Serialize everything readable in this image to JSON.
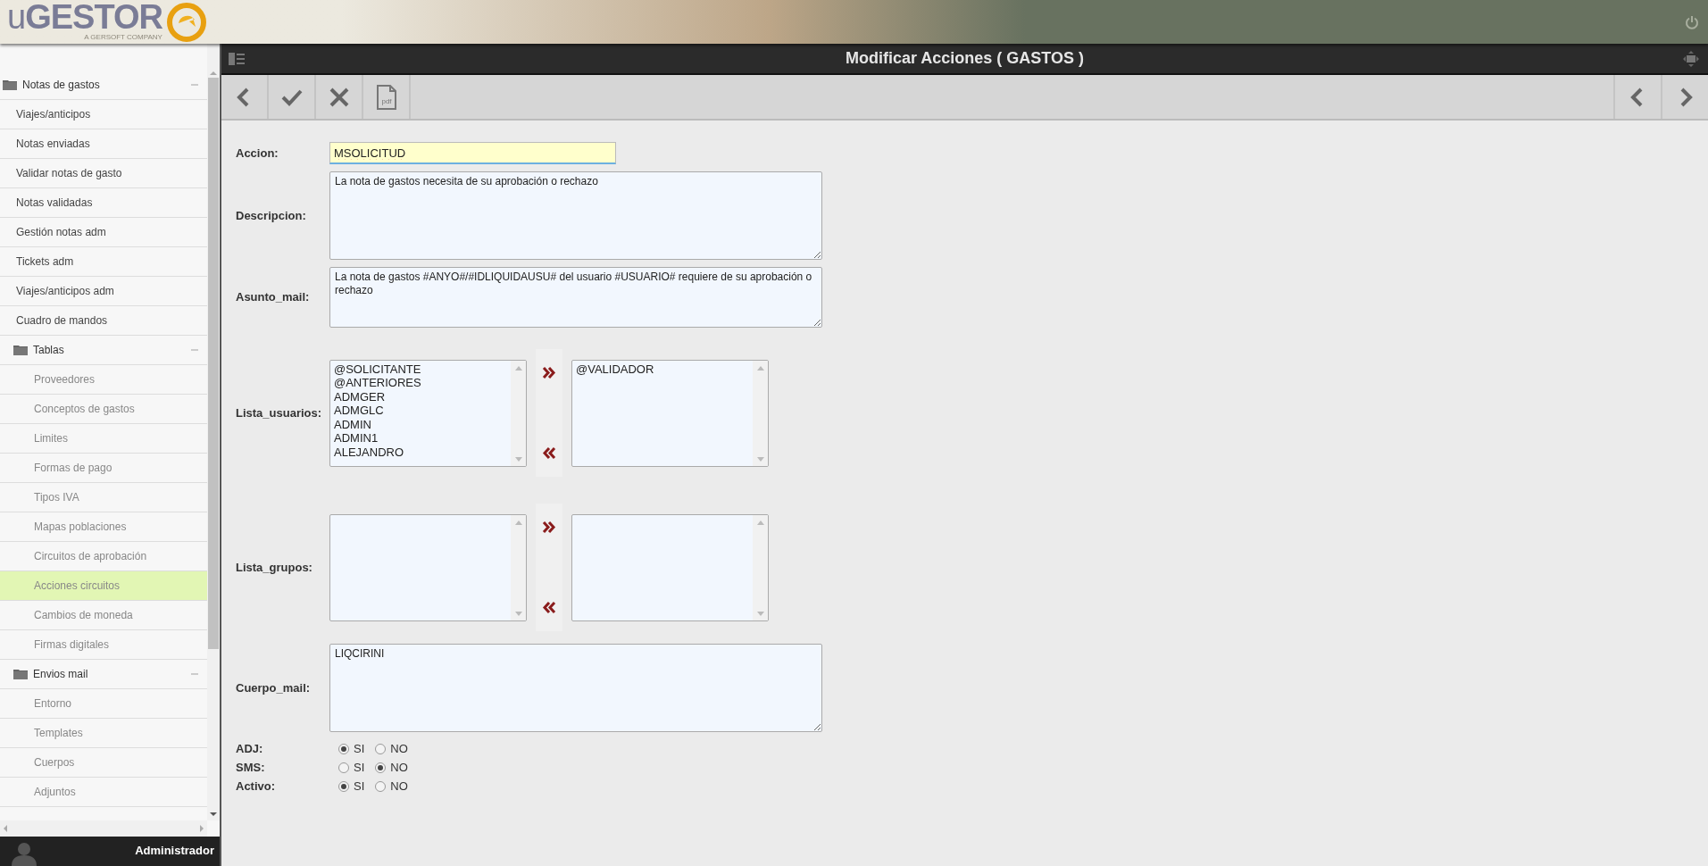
{
  "header": {
    "logo": "u**GESTOR**",
    "tagline": "A GERSOFT COMPANY"
  },
  "sidebar": {
    "items": [
      {
        "label": "Notas de gastos",
        "expanded": true,
        "selected": false,
        "children": [
          {
            "label": "Viajes/anticipos",
            "selected": false
          },
          {
            "label": "Notas enviadas",
            "selected": false
          },
          {
            "label": "Validar notas de gasto",
            "selected": false
          },
          {
            "label": "Notas validadas",
            "selected": false
          },
          {
            "label": "Gestión notas adm",
            "selected": false
          },
          {
            "label": "Tickets adm",
            "selected": false
          },
          {
            "label": "Viajes/anticipos adm",
            "selected": false
          },
          {
            "label": "Cuadro de mandos",
            "selected": false
          },
          {
            "label": "Tablas",
            "expanded": true,
            "selected": false,
            "children": [
              {
                "label": "Proveedores",
                "selected": false
              },
              {
                "label": "Conceptos de gastos",
                "selected": false
              },
              {
                "label": "Limites",
                "selected": false
              },
              {
                "label": "Formas de pago",
                "selected": false
              },
              {
                "label": "Tipos IVA",
                "selected": false
              },
              {
                "label": "Mapas poblaciones",
                "selected": false
              },
              {
                "label": "Circuitos de aprobación",
                "selected": false
              },
              {
                "label": "Acciones circuitos",
                "selected": true
              },
              {
                "label": "Cambios de moneda",
                "selected": false
              },
              {
                "label": "Firmas digitales",
                "selected": false
              }
            ]
          },
          {
            "label": "Envios mail",
            "expanded": true,
            "selected": false,
            "children": [
              {
                "label": "Entorno",
                "selected": false
              },
              {
                "label": "Templates",
                "selected": false
              },
              {
                "label": "Cuerpos",
                "selected": false
              },
              {
                "label": "Adjuntos",
                "selected": false
              }
            ]
          }
        ]
      }
    ]
  },
  "user": {
    "name": "Administrador"
  },
  "title": "Modificar Acciones ( GASTOS )",
  "toolbar": {
    "buttons": [
      {
        "kind": "back"
      },
      {
        "kind": "save"
      },
      {
        "kind": "cancel"
      },
      {
        "kind": "pdf",
        "label": "pdf"
      }
    ],
    "nav": [
      {
        "kind": "prev"
      },
      {
        "kind": "next"
      }
    ]
  },
  "form": {
    "fields": [
      {
        "kind": "input",
        "label": "Accion:",
        "value": "MSOLICITUD"
      },
      {
        "kind": "textarea",
        "label": "Descripcion:",
        "value": "La nota de gastos necesita de su aprobación o rechazo"
      },
      {
        "kind": "textarea_short",
        "label": "Asunto_mail:",
        "value": "La nota de gastos #ANYO#/#IDLIQUIDAUSU# del usuario #USUARIO# requiere de su aprobación o rechazo"
      },
      {
        "kind": "dual_list",
        "label": "Lista_usuarios:",
        "available": [
          "@SOLICITANTE",
          "@ANTERIORES",
          "ADMGER",
          "ADMGLC",
          "ADMIN",
          "ADMIN1",
          "ALEJANDRO"
        ],
        "chosen": [
          "@VALIDADOR"
        ]
      },
      {
        "kind": "dual_list",
        "label": "Lista_grupos:"
      },
      {
        "kind": "textarea",
        "label": "Cuerpo_mail:",
        "value": "LIQCIRINI"
      },
      {
        "kind": "radio",
        "label": "ADJ:",
        "options": [
          {
            "label": "SI",
            "selected": true
          },
          {
            "label": "NO",
            "selected": false
          }
        ]
      },
      {
        "kind": "radio",
        "label": "SMS:",
        "options": [
          {
            "label": "SI",
            "selected": false
          },
          {
            "label": "NO",
            "selected": true
          }
        ]
      },
      {
        "kind": "radio",
        "label": "Activo:",
        "options": [
          {
            "label": "SI",
            "selected": true
          },
          {
            "label": "NO",
            "selected": false
          }
        ]
      }
    ]
  }
}
